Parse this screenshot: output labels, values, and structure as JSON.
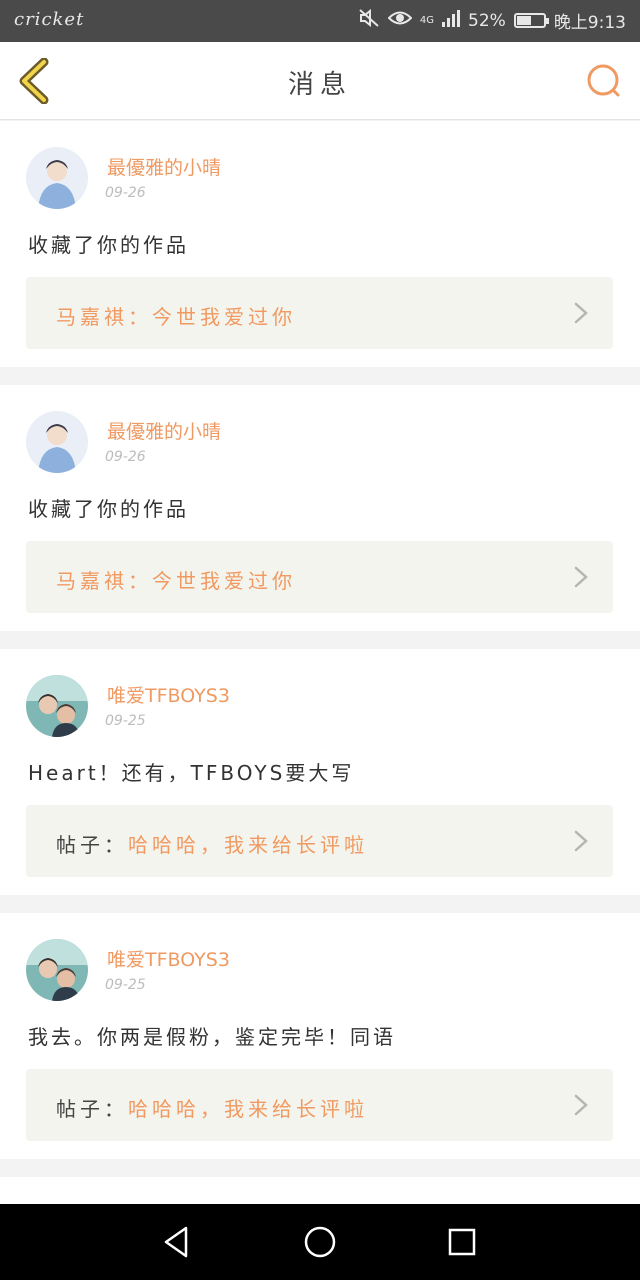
{
  "status_bar": {
    "carrier": "cricket",
    "network": "4G",
    "battery_percent": "52%",
    "battery_level": 0.52,
    "time": "晚上9:13"
  },
  "header": {
    "title": "消息",
    "accent_color": "#f09a62"
  },
  "messages": [
    {
      "user": "最優雅的小晴",
      "date": "09-26",
      "content": "收藏了你的作品",
      "ref_label": "",
      "ref_text": "马嘉祺：今世我爱过你",
      "avatar_icon": "avatar-boy-blue"
    },
    {
      "user": "最優雅的小晴",
      "date": "09-26",
      "content": "收藏了你的作品",
      "ref_label": "",
      "ref_text": "马嘉祺：今世我爱过你",
      "avatar_icon": "avatar-boy-blue"
    },
    {
      "user": "唯爱TFBOYS3",
      "date": "09-25",
      "content": "Heart！还有，TFBOYS要大写",
      "ref_label": "帖子：",
      "ref_text": "哈哈哈，我来给长评啦",
      "avatar_icon": "avatar-group-teal"
    },
    {
      "user": "唯爱TFBOYS3",
      "date": "09-25",
      "content": "我去。你两是假粉，鉴定完毕！同语",
      "ref_label": "帖子：",
      "ref_text": "哈哈哈，我来给长评啦",
      "avatar_icon": "avatar-group-teal"
    }
  ],
  "nav": {
    "back": "back-triangle-icon",
    "home": "home-circle-icon",
    "recents": "recents-square-icon"
  }
}
